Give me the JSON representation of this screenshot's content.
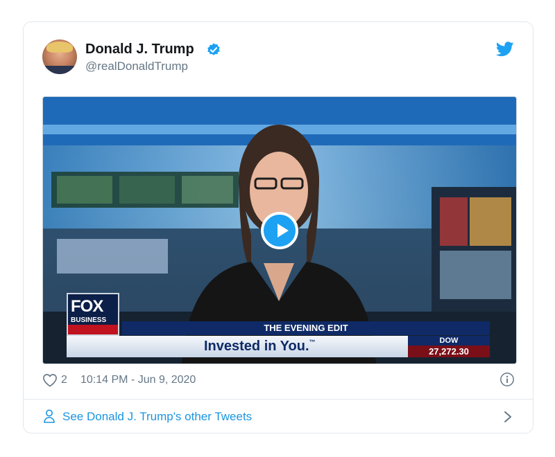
{
  "tweet": {
    "author_name": "Donald J. Trump",
    "author_handle": "@realDonaldTrump",
    "likes": "2",
    "timestamp": "10:14 PM - Jun 9, 2020"
  },
  "video": {
    "logo_word": "FOX",
    "logo_sub": "BUSINESS",
    "show_title": "THE EVENING EDIT",
    "tagline": "Invested in You.",
    "tagline_tm": "™",
    "ticker_label": "DOW",
    "ticker_value": "27,272.30"
  },
  "footer_link": {
    "label": "See Donald J. Trump's other Tweets"
  },
  "colors": {
    "accent": "#1da1f2",
    "link": "#1b95e0",
    "muted": "#657786"
  },
  "icons": [
    "verified-badge-icon",
    "twitter-bird-icon",
    "play-icon",
    "heart-icon",
    "info-icon",
    "person-icon",
    "chevron-right-icon"
  ]
}
